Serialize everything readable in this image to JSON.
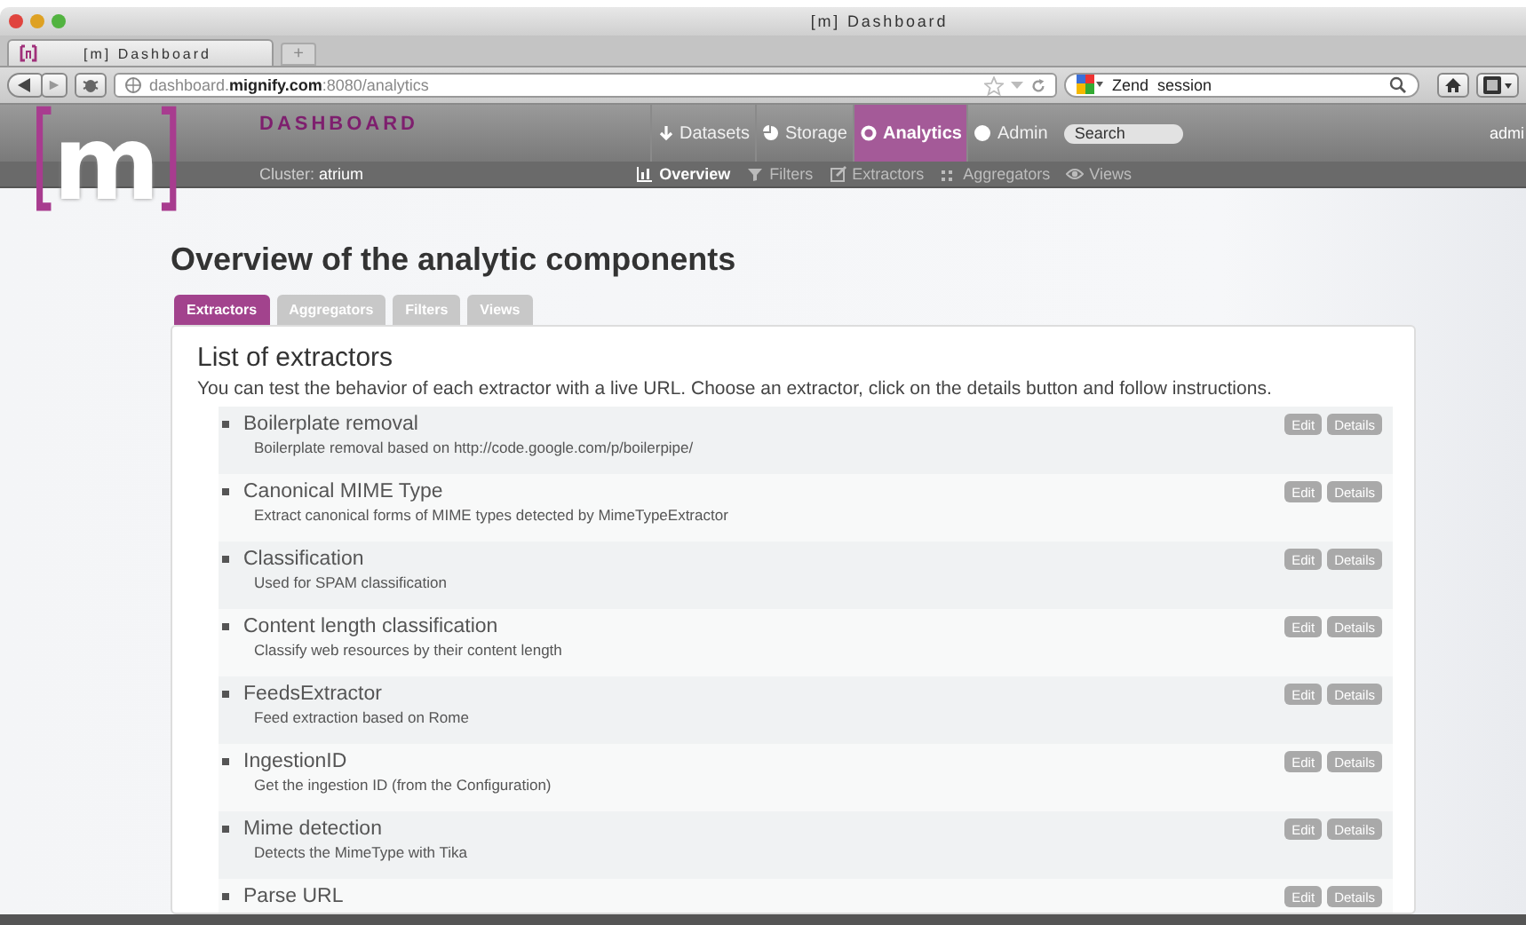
{
  "window": {
    "title": "[m] Dashboard"
  },
  "browser_tabs": [
    {
      "label": "[m] Dashboard",
      "selected": true
    }
  ],
  "new_tab": "+",
  "address_bar": {
    "value": "dashboard.**mignify.com**:8080/analytics"
  },
  "search_engine_field": {
    "value": "Zend  session"
  },
  "app": {
    "logo": {
      "left": "[",
      "letter": "m",
      "right": "]"
    },
    "brand": "DASHBOARD",
    "nav": [
      {
        "label": "Datasets",
        "selected": false
      },
      {
        "label": "Storage",
        "selected": false
      },
      {
        "label": "Analytics",
        "selected": true
      },
      {
        "label": "Admin",
        "selected": false
      }
    ],
    "search": {
      "placeholder": "Search"
    },
    "user": "admi",
    "cluster": "Cluster: **atrium**",
    "subnav": [
      {
        "label": "Overview",
        "selected": true
      },
      {
        "label": "Filters",
        "selected": false
      },
      {
        "label": "Extractors",
        "selected": false
      },
      {
        "label": "Aggregators",
        "selected": false
      },
      {
        "label": "Views",
        "selected": false
      }
    ]
  },
  "page": {
    "title": "Overview of the analytic components",
    "tabs": [
      {
        "label": "Extractors",
        "selected": true
      },
      {
        "label": "Aggregators",
        "selected": false
      },
      {
        "label": "Filters",
        "selected": false
      },
      {
        "label": "Views",
        "selected": false
      }
    ],
    "panel": {
      "heading": "List of extractors",
      "intro": "You can test the behavior of each extractor with a live URL. Choose an extractor, click on the details button and follow instructions.",
      "items": [
        {
          "name": "Boilerplate removal",
          "description": "Boilerplate removal based on http://code.google.com/p/boilerpipe/",
          "actions": [
            "Edit",
            "Details"
          ]
        },
        {
          "name": "Canonical MIME Type",
          "description": "Extract canonical forms of MIME types detected by MimeTypeExtractor",
          "actions": [
            "Edit",
            "Details"
          ]
        },
        {
          "name": "Classification",
          "description": "Used for SPAM classification",
          "actions": [
            "Edit",
            "Details"
          ]
        },
        {
          "name": "Content length classification",
          "description": "Classify web resources by their content length",
          "actions": [
            "Edit",
            "Details"
          ]
        },
        {
          "name": "FeedsExtractor",
          "description": "Feed extraction based on Rome",
          "actions": [
            "Edit",
            "Details"
          ]
        },
        {
          "name": "IngestionID",
          "description": "Get the ingestion ID (from the Configuration)",
          "actions": [
            "Edit",
            "Details"
          ]
        },
        {
          "name": "Mime detection",
          "description": "Detects the MimeType with Tika",
          "actions": [
            "Edit",
            "Details"
          ]
        },
        {
          "name": "Parse URL",
          "actions": [
            "Edit",
            "Details"
          ]
        }
      ]
    }
  }
}
